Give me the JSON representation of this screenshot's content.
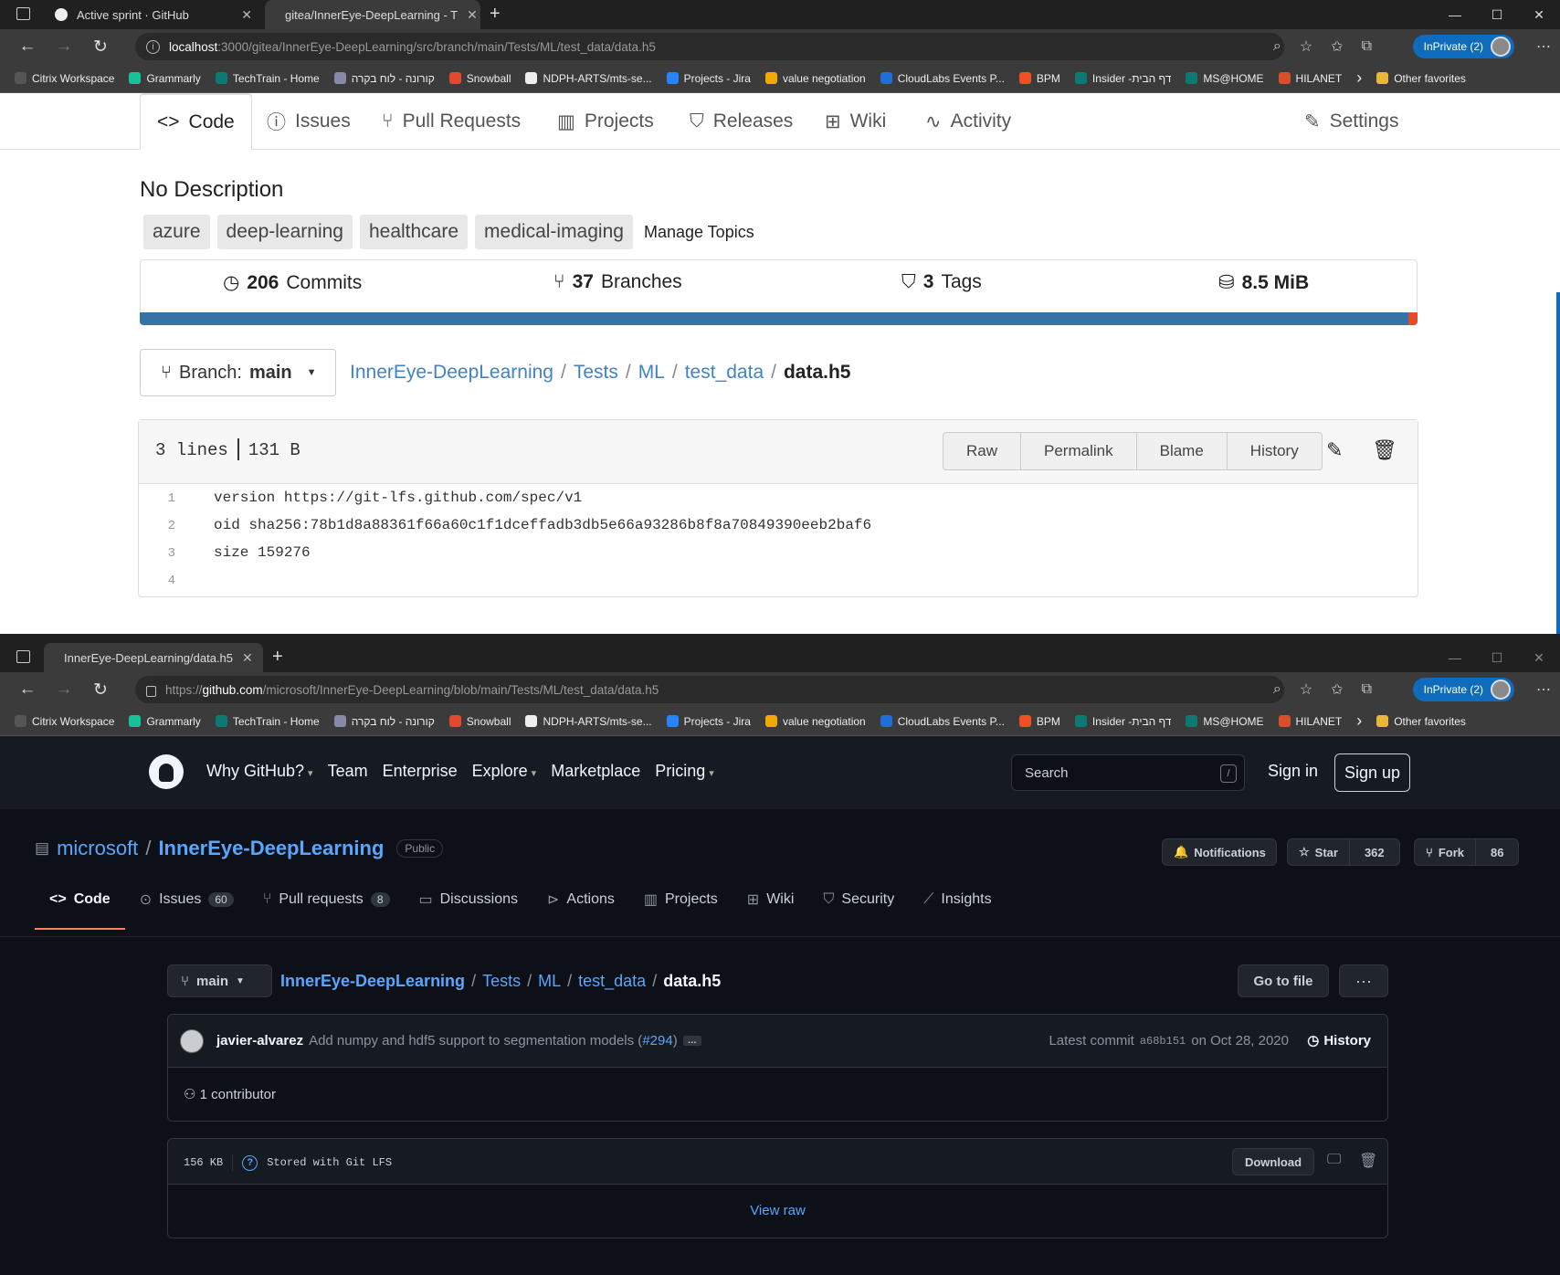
{
  "window1": {
    "tabs": [
      {
        "title": "Active sprint · GitHub",
        "icon": "github-icon"
      },
      {
        "title": "gitea/InnerEye-DeepLearning - T",
        "icon": "gitea-icon"
      }
    ],
    "url_host": "localhost",
    "url_rest": ":3000/gitea/InnerEye-DeepLearning/src/branch/main/Tests/ML/test_data/data.h5",
    "inprivate": "InPrivate (2)"
  },
  "window2": {
    "tabs": [
      {
        "title": "InnerEye-DeepLearning/data.h5",
        "icon": "github-icon"
      }
    ],
    "url_prefix": "https://",
    "url_host": "github.com",
    "url_rest": "/microsoft/InnerEye-DeepLearning/blob/main/Tests/ML/test_data/data.h5",
    "inprivate": "InPrivate (2)"
  },
  "bookmarks": [
    {
      "label": "Citrix Workspace",
      "color": "#555555"
    },
    {
      "label": "Grammarly",
      "color": "#15c39a"
    },
    {
      "label": "TechTrain - Home",
      "color": "#0b7a75"
    },
    {
      "label": "קורונה - לוח בקרה",
      "color": "#8888aa"
    },
    {
      "label": "Snowball",
      "color": "#e04a2f"
    },
    {
      "label": "NDPH-ARTS/mts-se...",
      "color": "#eeeeee"
    },
    {
      "label": "Projects - Jira",
      "color": "#2684ff"
    },
    {
      "label": "value negotiation",
      "color": "#f2a900"
    },
    {
      "label": "CloudLabs Events P...",
      "color": "#1e6fd9"
    },
    {
      "label": "BPM",
      "color": "#f25022"
    },
    {
      "label": "Insider -דף הבית",
      "color": "#0b7a75"
    },
    {
      "label": "MS@HOME",
      "color": "#0b7a75"
    },
    {
      "label": "HILANET",
      "color": "#d94f2a"
    }
  ],
  "other_favorites": "Other favorites",
  "gitea": {
    "tabs": [
      {
        "label": "Code",
        "icon": "code-icon"
      },
      {
        "label": "Issues",
        "icon": "issue-icon"
      },
      {
        "label": "Pull Requests",
        "icon": "pull-request-icon"
      },
      {
        "label": "Projects",
        "icon": "project-icon"
      },
      {
        "label": "Releases",
        "icon": "tag-icon"
      },
      {
        "label": "Wiki",
        "icon": "book-icon"
      },
      {
        "label": "Activity",
        "icon": "pulse-icon"
      },
      {
        "label": "Settings",
        "icon": "tools-icon"
      }
    ],
    "description": "No Description",
    "topics": [
      "azure",
      "deep-learning",
      "healthcare",
      "medical-imaging"
    ],
    "manage_topics": "Manage Topics",
    "stats": {
      "commits_num": "206",
      "commits_label": "Commits",
      "branches_num": "37",
      "branches_label": "Branches",
      "tags_num": "3",
      "tags_label": "Tags",
      "size": "8.5 MiB"
    },
    "branch_label": "Branch:",
    "branch_name": "main",
    "breadcrumb": [
      "InnerEye-DeepLearning",
      "Tests",
      "ML",
      "test_data"
    ],
    "filename": "data.h5",
    "file_lines": "3 lines",
    "file_size": "131 B",
    "file_buttons": [
      "Raw",
      "Permalink",
      "Blame",
      "History"
    ],
    "code": [
      {
        "n": "1",
        "text": "version https://git-lfs.github.com/spec/v1"
      },
      {
        "n": "2",
        "text": "oid sha256:78b1d8a88361f66a60c1f1dceffadb3db5e66a93286b8f8a70849390eeb2baf6"
      },
      {
        "n": "3",
        "text": "size 159276"
      },
      {
        "n": "4",
        "text": ""
      }
    ]
  },
  "github": {
    "nav": [
      "Why GitHub?",
      "Team",
      "Enterprise",
      "Explore",
      "Marketplace",
      "Pricing"
    ],
    "search_placeholder": "Search",
    "search_key": "/",
    "sign_in": "Sign in",
    "sign_up": "Sign up",
    "owner": "microsoft",
    "repo": "InnerEye-DeepLearning",
    "visibility": "Public",
    "notifications": "Notifications",
    "star": "Star",
    "star_count": "362",
    "fork": "Fork",
    "fork_count": "86",
    "tabs": [
      {
        "label": "Code",
        "count": ""
      },
      {
        "label": "Issues",
        "count": "60"
      },
      {
        "label": "Pull requests",
        "count": "8"
      },
      {
        "label": "Discussions",
        "count": ""
      },
      {
        "label": "Actions",
        "count": ""
      },
      {
        "label": "Projects",
        "count": ""
      },
      {
        "label": "Wiki",
        "count": ""
      },
      {
        "label": "Security",
        "count": ""
      },
      {
        "label": "Insights",
        "count": ""
      }
    ],
    "branch": "main",
    "breadcrumb": [
      "InnerEye-DeepLearning",
      "Tests",
      "ML",
      "test_data"
    ],
    "filename": "data.h5",
    "go_to_file": "Go to file",
    "more": "···",
    "commit_author": "javier-alvarez",
    "commit_msg": "Add numpy and hdf5 support to segmentation models (",
    "commit_pr": "#294",
    "commit_close": ")",
    "commit_ellipsis": "…",
    "latest_commit_label": "Latest commit",
    "latest_commit_sha": "a68b151",
    "latest_commit_date": "on Oct 28, 2020",
    "history": "History",
    "contributors": "1 contributor",
    "file_size": "156 KB",
    "lfs_label": "Stored with Git LFS",
    "download": "Download",
    "view_raw": "View raw"
  }
}
